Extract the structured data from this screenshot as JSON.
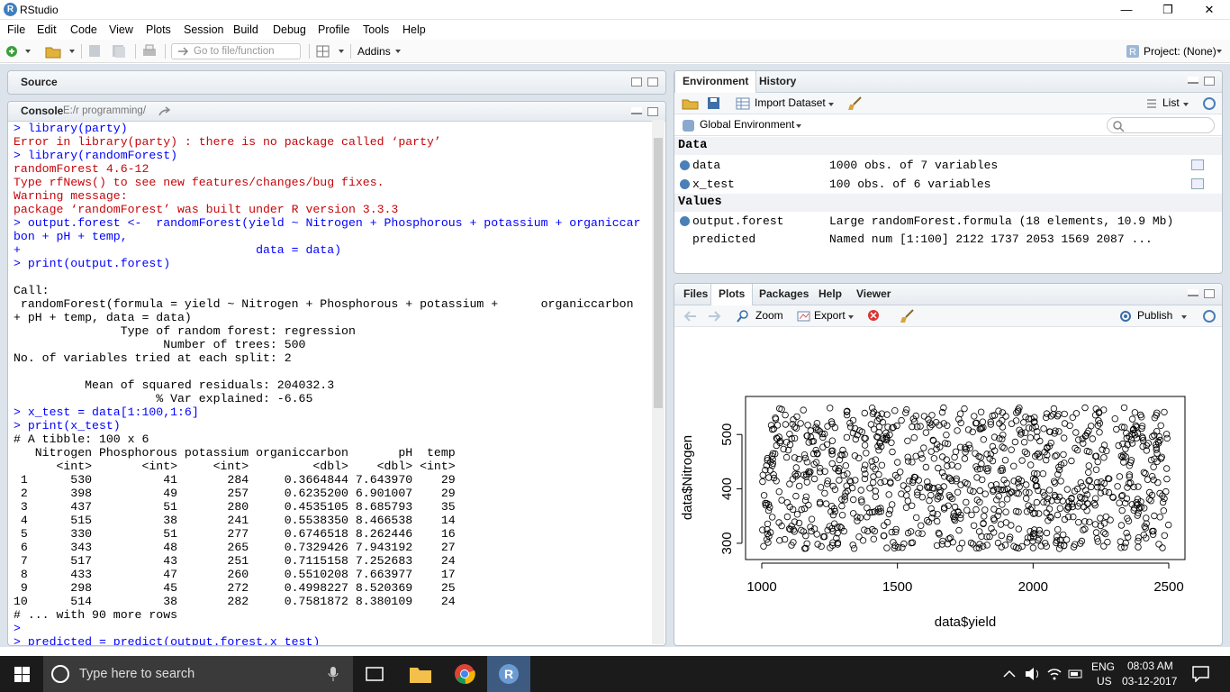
{
  "window": {
    "title": "RStudio",
    "controls": [
      "—",
      "❐",
      "✕"
    ]
  },
  "menu": [
    "File",
    "Edit",
    "Code",
    "View",
    "Plots",
    "Session",
    "Build",
    "Debug",
    "Profile",
    "Tools",
    "Help"
  ],
  "toolbar": {
    "goto_placeholder": "Go to file/function",
    "addins": "Addins",
    "project": "Project: (None)"
  },
  "source_pane": {
    "title": "Source"
  },
  "console_pane": {
    "title": "Console",
    "path": "E:/r programming/",
    "lines": [
      {
        "t": "in",
        "s": "> library(party)"
      },
      {
        "t": "err",
        "s": "Error in library(party) : there is no package called ‘party’"
      },
      {
        "t": "in",
        "s": "> library(randomForest)"
      },
      {
        "t": "err",
        "s": "randomForest 4.6-12"
      },
      {
        "t": "err",
        "s": "Type rfNews() to see new features/changes/bug fixes."
      },
      {
        "t": "err",
        "s": "Warning message:"
      },
      {
        "t": "err",
        "s": "package ‘randomForest’ was built under R version 3.3.3"
      },
      {
        "t": "in",
        "s": "> output.forest <-  randomForest(yield ~ Nitrogen + Phosphorous + potassium + organiccar"
      },
      {
        "t": "in",
        "s": "bon + pH + temp,"
      },
      {
        "t": "in",
        "s": "+                                 data = data)"
      },
      {
        "t": "in",
        "s": "> print(output.forest)"
      },
      {
        "t": "out",
        "s": ""
      },
      {
        "t": "out",
        "s": "Call:"
      },
      {
        "t": "out",
        "s": " randomForest(formula = yield ~ Nitrogen + Phosphorous + potassium +      organiccarbon"
      },
      {
        "t": "out",
        "s": "+ pH + temp, data = data)"
      },
      {
        "t": "out",
        "s": "               Type of random forest: regression"
      },
      {
        "t": "out",
        "s": "                     Number of trees: 500"
      },
      {
        "t": "out",
        "s": "No. of variables tried at each split: 2"
      },
      {
        "t": "out",
        "s": ""
      },
      {
        "t": "out",
        "s": "          Mean of squared residuals: 204032.3"
      },
      {
        "t": "out",
        "s": "                    % Var explained: -6.65"
      },
      {
        "t": "in",
        "s": "> x_test = data[1:100,1:6]"
      },
      {
        "t": "in",
        "s": "> print(x_test)"
      },
      {
        "t": "out",
        "s": "# A tibble: 100 x 6"
      },
      {
        "t": "out",
        "s": "   Nitrogen Phosphorous potassium organiccarbon       pH  temp"
      },
      {
        "t": "out",
        "s": "      <int>       <int>     <int>         <dbl>    <dbl> <int>"
      },
      {
        "t": "out",
        "s": " 1      530          41       284     0.3664844 7.643970    29"
      },
      {
        "t": "out",
        "s": " 2      398          49       257     0.6235200 6.901007    29"
      },
      {
        "t": "out",
        "s": " 3      437          51       280     0.4535105 8.685793    35"
      },
      {
        "t": "out",
        "s": " 4      515          38       241     0.5538350 8.466538    14"
      },
      {
        "t": "out",
        "s": " 5      330          51       277     0.6746518 8.262446    16"
      },
      {
        "t": "out",
        "s": " 6      343          48       265     0.7329426 7.943192    27"
      },
      {
        "t": "out",
        "s": " 7      517          43       251     0.7115158 7.252683    24"
      },
      {
        "t": "out",
        "s": " 8      433          47       260     0.5510208 7.663977    17"
      },
      {
        "t": "out",
        "s": " 9      298          45       272     0.4998227 8.520369    25"
      },
      {
        "t": "out",
        "s": "10      514          38       282     0.7581872 8.380109    24"
      },
      {
        "t": "out",
        "s": "# ... with 90 more rows"
      },
      {
        "t": "in",
        "s": ">"
      },
      {
        "t": "in",
        "s": "> predicted = predict(output.forest,x_test)"
      }
    ]
  },
  "env_pane": {
    "tabs": [
      "Environment",
      "History"
    ],
    "import_label": "Import Dataset",
    "list_label": "List",
    "scope": "Global Environment",
    "data_header": "Data",
    "values_header": "Values",
    "data_rows": [
      {
        "name": "data",
        "value": "1000 obs. of 7 variables"
      },
      {
        "name": "x_test",
        "value": "100 obs. of 6 variables"
      }
    ],
    "value_rows": [
      {
        "name": "output.forest",
        "value": "Large randomForest.formula (18 elements, 10.9 Mb)"
      },
      {
        "name": "predicted",
        "value": "Named num [1:100] 2122 1737 2053 1569 2087 ..."
      }
    ]
  },
  "plots_pane": {
    "tabs": [
      "Files",
      "Plots",
      "Packages",
      "Help",
      "Viewer"
    ],
    "zoom": "Zoom",
    "export": "Export",
    "publish": "Publish"
  },
  "chart_data": {
    "type": "scatter",
    "xlabel": "data$yield",
    "ylabel": "data$Nitrogen",
    "xlim": [
      1000,
      2500
    ],
    "ylim": [
      280,
      560
    ],
    "xticks": [
      "1000",
      "1500",
      "2000",
      "2500"
    ],
    "yticks": [
      "300",
      "400",
      "500"
    ],
    "n_points": 1000,
    "distribution": "uniform random scatter over x 1000–2500 and y 280–560"
  },
  "taskbar": {
    "search": "Type here to search",
    "lang1": "ENG",
    "lang2": "US",
    "time": "08:03 AM",
    "date": "03-12-2017"
  },
  "colors": {
    "console_input": "#0000ff",
    "console_error": "#c5060b",
    "pane_border": "#b9c2cb",
    "taskbar": "#1b1b1b"
  }
}
